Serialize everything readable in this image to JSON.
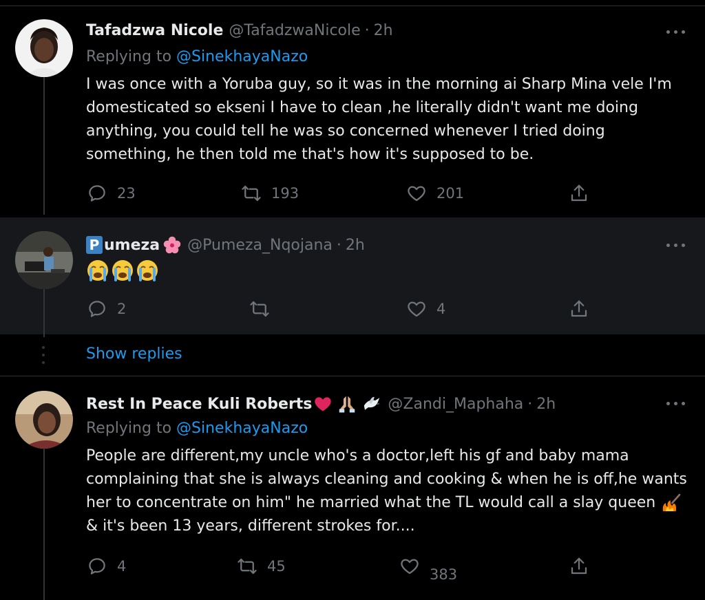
{
  "colors": {
    "background": "#000000",
    "row_highlight": "#16181c",
    "link": "#1d9bf0",
    "muted": "#71767b",
    "text": "#e7e9ea",
    "like_icon": "#71767b"
  },
  "tweet1": {
    "name": "Tafadzwa Nicole",
    "handle": "@TafadzwaNicole",
    "sep": "·",
    "time": "2h",
    "replying_prefix": "Replying to",
    "replying_to": "@SinekhayaNazo",
    "text": "I was once with a Yoruba guy, so it was in the morning ai Sharp Mina vele I'm domesticated so ekseni I have to clean ,he literally didn't want me doing anything, you could tell he was so concerned whenever I tried doing something, he then told me that's how it's supposed to be.",
    "replies": "23",
    "retweets": "193",
    "likes": "201"
  },
  "tweet2": {
    "name_badge": "P",
    "name": "umeza",
    "handle": "@Pumeza_Nqojana",
    "sep": "·",
    "time": "2h",
    "text_emoji": "loudly-crying-face x3",
    "replies": "2",
    "retweets": "",
    "likes": "4"
  },
  "show_replies": "Show replies",
  "tweet3": {
    "name": "Rest In Peace Kuli Roberts",
    "handle": "@Zandi_Maphaha",
    "sep": "·",
    "time": "2h",
    "replying_prefix": "Replying to",
    "replying_to": "@SinekhayaNazo",
    "text_before_emoji": "People are different,my uncle who's a doctor,left his gf and baby mama complaining that she is always cleaning and cooking & when he is off,he wants her to concentrate on him\" he married what the TL would call a slay queen",
    "text_after_emoji": "& it's been 13 years, different strokes for....",
    "replies": "4",
    "retweets": "45",
    "likes": "383"
  }
}
